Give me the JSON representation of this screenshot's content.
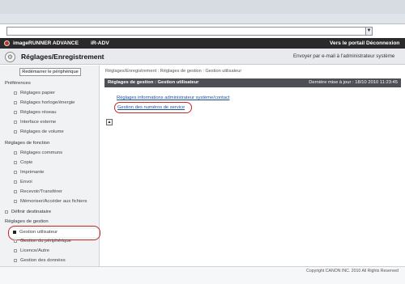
{
  "app": {
    "brand": "imageRUNNER ADVANCE",
    "model": "iR-ADV",
    "portal_link": "Vers le portail",
    "logout_link": "Déconnexion"
  },
  "page": {
    "title": "Réglages/Enregistrement",
    "email_admin": "Envoyer par e-mail à l'administrateur système"
  },
  "sidebar": {
    "restart_button": "Redémarrer le périphérique",
    "sections": [
      "Préférences",
      "Réglages de fonction",
      "Définir destinataire",
      "Réglages de gestion"
    ],
    "pref_items": [
      "Réglages papier",
      "Réglages horloge/énergie",
      "Réglages réseau",
      "Interface externe",
      "Réglages de volume"
    ],
    "func_items": [
      "Réglages communs",
      "Copie",
      "Imprimante",
      "Envoi",
      "Recevoir/Transférer",
      "Mémoriser/Accéder aux fichiers"
    ],
    "mgmt_items": [
      "Gestion utilisateur",
      "Gestion du périphérique",
      "Licence/Autre",
      "Gestion des données"
    ]
  },
  "main": {
    "breadcrumb": "Réglages/Enregistrement : Réglages de gestion : Gestion utilisateur",
    "section_title": "Réglages de gestion : Gestion utilisateur",
    "last_update": "Dernière mise à jour : 18/10 2010 11:23:45",
    "links": [
      "Réglages informations administrateur système/contact",
      "Gestion des numéros de service"
    ],
    "top_button": "▲"
  },
  "footer": {
    "copyright": "Copyright CANON INC. 2010 All Rights Reserved"
  }
}
